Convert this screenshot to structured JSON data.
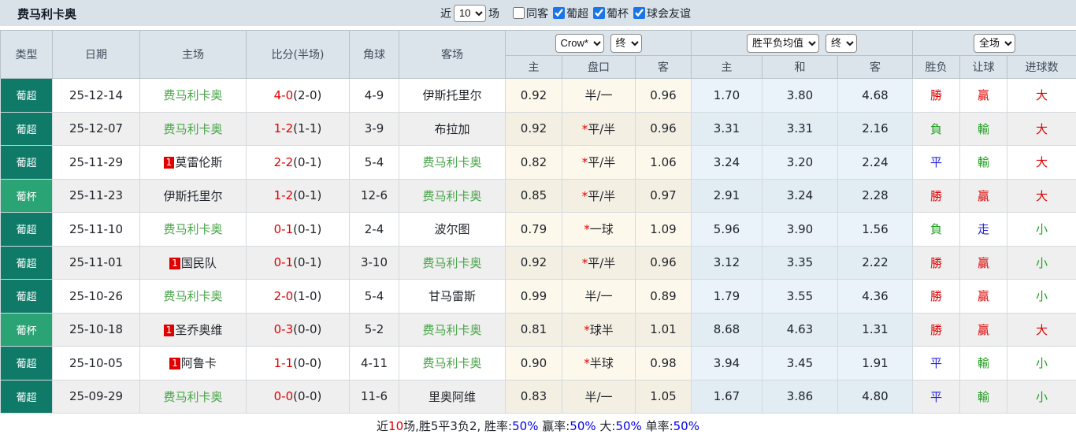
{
  "colors": {
    "red": "#e10000",
    "green": "#1f9e1f",
    "blue": "#2222dd",
    "team": "#47a447",
    "super": "#0f7a68",
    "cup": "#2aa474",
    "sumblue": "#0000e6"
  },
  "topbar": {
    "title": "费马利卡奥",
    "recent_label": "近",
    "recent_value": "10",
    "recent_suffix": "场",
    "checkboxes": [
      {
        "label": "同客",
        "checked": false
      },
      {
        "label": "葡超",
        "checked": true
      },
      {
        "label": "葡杯",
        "checked": true
      },
      {
        "label": "球会友谊",
        "checked": true
      }
    ]
  },
  "table": {
    "header": {
      "type": "类型",
      "date": "日期",
      "home": "主场",
      "score": "比分(半场)",
      "corner": "角球",
      "away": "客场",
      "bookmaker": "Crow*",
      "bookmaker_time": "终",
      "mean": "胜平负均值",
      "mean_time": "终",
      "scope": "全场",
      "sub_home": "主",
      "sub_handicap": "盘口",
      "sub_away": "客",
      "sub_mean_home": "主",
      "sub_mean_draw": "和",
      "sub_mean_away": "客",
      "sub_result": "胜负",
      "sub_handicap_result": "让球",
      "sub_goals": "进球数"
    },
    "rows": [
      {
        "league": "葡超",
        "league_type": "super",
        "date": "25-12-14",
        "home": {
          "name": "费马利卡奥",
          "self": true,
          "badge": ""
        },
        "score": "4-0",
        "half": "(2-0)",
        "corner": "4-9",
        "away": {
          "name": "伊斯托里尔",
          "self": false,
          "badge": ""
        },
        "odds_home": "0.92",
        "handicap_star": false,
        "handicap": "半/一",
        "odds_away": "0.96",
        "mean_home": "1.70",
        "mean_draw": "3.80",
        "mean_away": "4.68",
        "result": {
          "t": "勝",
          "c": "red"
        },
        "handicap_result": {
          "t": "贏",
          "c": "red"
        },
        "goals": {
          "t": "大",
          "c": "red"
        }
      },
      {
        "league": "葡超",
        "league_type": "super",
        "date": "25-12-07",
        "home": {
          "name": "费马利卡奥",
          "self": true,
          "badge": ""
        },
        "score": "1-2",
        "half": "(1-1)",
        "corner": "3-9",
        "away": {
          "name": "布拉加",
          "self": false,
          "badge": ""
        },
        "odds_home": "0.92",
        "handicap_star": true,
        "handicap": "平/半",
        "odds_away": "0.96",
        "mean_home": "3.31",
        "mean_draw": "3.31",
        "mean_away": "2.16",
        "result": {
          "t": "負",
          "c": "green"
        },
        "handicap_result": {
          "t": "輸",
          "c": "green"
        },
        "goals": {
          "t": "大",
          "c": "red"
        }
      },
      {
        "league": "葡超",
        "league_type": "super",
        "date": "25-11-29",
        "home": {
          "name": "莫雷伦斯",
          "self": false,
          "badge": "1"
        },
        "score": "2-2",
        "half": "(0-1)",
        "corner": "5-4",
        "away": {
          "name": "费马利卡奥",
          "self": true,
          "badge": ""
        },
        "odds_home": "0.82",
        "handicap_star": true,
        "handicap": "平/半",
        "odds_away": "1.06",
        "mean_home": "3.24",
        "mean_draw": "3.20",
        "mean_away": "2.24",
        "result": {
          "t": "平",
          "c": "blue"
        },
        "handicap_result": {
          "t": "輸",
          "c": "green"
        },
        "goals": {
          "t": "大",
          "c": "red"
        }
      },
      {
        "league": "葡杯",
        "league_type": "cup",
        "date": "25-11-23",
        "home": {
          "name": "伊斯托里尔",
          "self": false,
          "badge": ""
        },
        "score": "1-2",
        "half": "(0-1)",
        "corner": "12-6",
        "away": {
          "name": "费马利卡奥",
          "self": true,
          "badge": ""
        },
        "odds_home": "0.85",
        "handicap_star": true,
        "handicap": "平/半",
        "odds_away": "0.97",
        "mean_home": "2.91",
        "mean_draw": "3.24",
        "mean_away": "2.28",
        "result": {
          "t": "勝",
          "c": "red"
        },
        "handicap_result": {
          "t": "贏",
          "c": "red"
        },
        "goals": {
          "t": "大",
          "c": "red"
        }
      },
      {
        "league": "葡超",
        "league_type": "super",
        "date": "25-11-10",
        "home": {
          "name": "费马利卡奥",
          "self": true,
          "badge": ""
        },
        "score": "0-1",
        "half": "(0-1)",
        "corner": "2-4",
        "away": {
          "name": "波尔图",
          "self": false,
          "badge": ""
        },
        "odds_home": "0.79",
        "handicap_star": true,
        "handicap": "一球",
        "odds_away": "1.09",
        "mean_home": "5.96",
        "mean_draw": "3.90",
        "mean_away": "1.56",
        "result": {
          "t": "負",
          "c": "green"
        },
        "handicap_result": {
          "t": "走",
          "c": "blue"
        },
        "goals": {
          "t": "小",
          "c": "green"
        }
      },
      {
        "league": "葡超",
        "league_type": "super",
        "date": "25-11-01",
        "home": {
          "name": "国民队",
          "self": false,
          "badge": "1"
        },
        "score": "0-1",
        "half": "(0-1)",
        "corner": "3-10",
        "away": {
          "name": "费马利卡奥",
          "self": true,
          "badge": ""
        },
        "odds_home": "0.92",
        "handicap_star": true,
        "handicap": "平/半",
        "odds_away": "0.96",
        "mean_home": "3.12",
        "mean_draw": "3.35",
        "mean_away": "2.22",
        "result": {
          "t": "勝",
          "c": "red"
        },
        "handicap_result": {
          "t": "贏",
          "c": "red"
        },
        "goals": {
          "t": "小",
          "c": "green"
        }
      },
      {
        "league": "葡超",
        "league_type": "super",
        "date": "25-10-26",
        "home": {
          "name": "费马利卡奥",
          "self": true,
          "badge": ""
        },
        "score": "2-0",
        "half": "(1-0)",
        "corner": "5-4",
        "away": {
          "name": "甘马雷斯",
          "self": false,
          "badge": ""
        },
        "odds_home": "0.99",
        "handicap_star": false,
        "handicap": "半/一",
        "odds_away": "0.89",
        "mean_home": "1.79",
        "mean_draw": "3.55",
        "mean_away": "4.36",
        "result": {
          "t": "勝",
          "c": "red"
        },
        "handicap_result": {
          "t": "贏",
          "c": "red"
        },
        "goals": {
          "t": "小",
          "c": "green"
        }
      },
      {
        "league": "葡杯",
        "league_type": "cup",
        "date": "25-10-18",
        "home": {
          "name": "圣乔奥维",
          "self": false,
          "badge": "1"
        },
        "score": "0-3",
        "half": "(0-0)",
        "corner": "5-2",
        "away": {
          "name": "费马利卡奥",
          "self": true,
          "badge": ""
        },
        "odds_home": "0.81",
        "handicap_star": true,
        "handicap": "球半",
        "odds_away": "1.01",
        "mean_home": "8.68",
        "mean_draw": "4.63",
        "mean_away": "1.31",
        "result": {
          "t": "勝",
          "c": "red"
        },
        "handicap_result": {
          "t": "贏",
          "c": "red"
        },
        "goals": {
          "t": "大",
          "c": "red"
        }
      },
      {
        "league": "葡超",
        "league_type": "super",
        "date": "25-10-05",
        "home": {
          "name": "阿鲁卡",
          "self": false,
          "badge": "1"
        },
        "score": "1-1",
        "half": "(0-0)",
        "corner": "4-11",
        "away": {
          "name": "费马利卡奥",
          "self": true,
          "badge": ""
        },
        "odds_home": "0.90",
        "handicap_star": true,
        "handicap": "半球",
        "odds_away": "0.98",
        "mean_home": "3.94",
        "mean_draw": "3.45",
        "mean_away": "1.91",
        "result": {
          "t": "平",
          "c": "blue"
        },
        "handicap_result": {
          "t": "輸",
          "c": "green"
        },
        "goals": {
          "t": "小",
          "c": "green"
        }
      },
      {
        "league": "葡超",
        "league_type": "super",
        "date": "25-09-29",
        "home": {
          "name": "费马利卡奥",
          "self": true,
          "badge": ""
        },
        "score": "0-0",
        "half": "(0-0)",
        "corner": "11-6",
        "away": {
          "name": "里奥阿维",
          "self": false,
          "badge": ""
        },
        "odds_home": "0.83",
        "handicap_star": false,
        "handicap": "半/一",
        "odds_away": "1.05",
        "mean_home": "1.67",
        "mean_draw": "3.86",
        "mean_away": "4.80",
        "result": {
          "t": "平",
          "c": "blue"
        },
        "handicap_result": {
          "t": "輸",
          "c": "green"
        },
        "goals": {
          "t": "小",
          "c": "green"
        }
      }
    ]
  },
  "summary": {
    "segments": [
      {
        "t": "近",
        "c": "dark"
      },
      {
        "t": "10",
        "c": "red"
      },
      {
        "t": "场,胜5平3负2, 胜率:",
        "c": "dark"
      },
      {
        "t": "50%",
        "c": "sumblue"
      },
      {
        "t": " 赢率:",
        "c": "dark"
      },
      {
        "t": "50%",
        "c": "sumblue"
      },
      {
        "t": " 大:",
        "c": "dark"
      },
      {
        "t": "50%",
        "c": "sumblue"
      },
      {
        "t": " 单率:",
        "c": "dark"
      },
      {
        "t": "50%",
        "c": "sumblue"
      }
    ]
  }
}
